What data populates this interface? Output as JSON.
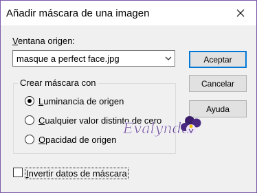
{
  "dialog": {
    "title": "Añadir máscara de una imagen",
    "close_icon": "close-icon"
  },
  "source": {
    "label_hotkey": "V",
    "label_rest": "entana origen:",
    "selected": "masque  a perfect face.jpg"
  },
  "buttons": {
    "accept": "Aceptar",
    "cancel": "Cancelar",
    "help": "Ayuda"
  },
  "mask_group": {
    "title": "Crear máscara con",
    "options": [
      {
        "hotkey": "L",
        "rest": "uminancia de origen",
        "checked": true
      },
      {
        "hotkey": "C",
        "rest": "ualquier valor distinto de cero",
        "checked": false
      },
      {
        "hotkey": "O",
        "rest": "pacidad de origen",
        "checked": false
      }
    ]
  },
  "invert": {
    "hotkey": "I",
    "rest": "nvertir datos de máscara",
    "checked": false
  },
  "watermark": {
    "text": "Evalynda",
    "icon": "pansy-flower-icon"
  },
  "colors": {
    "frame": "#5b3b86",
    "accent": "#0078d7",
    "watermark": "#6a4a9a"
  }
}
